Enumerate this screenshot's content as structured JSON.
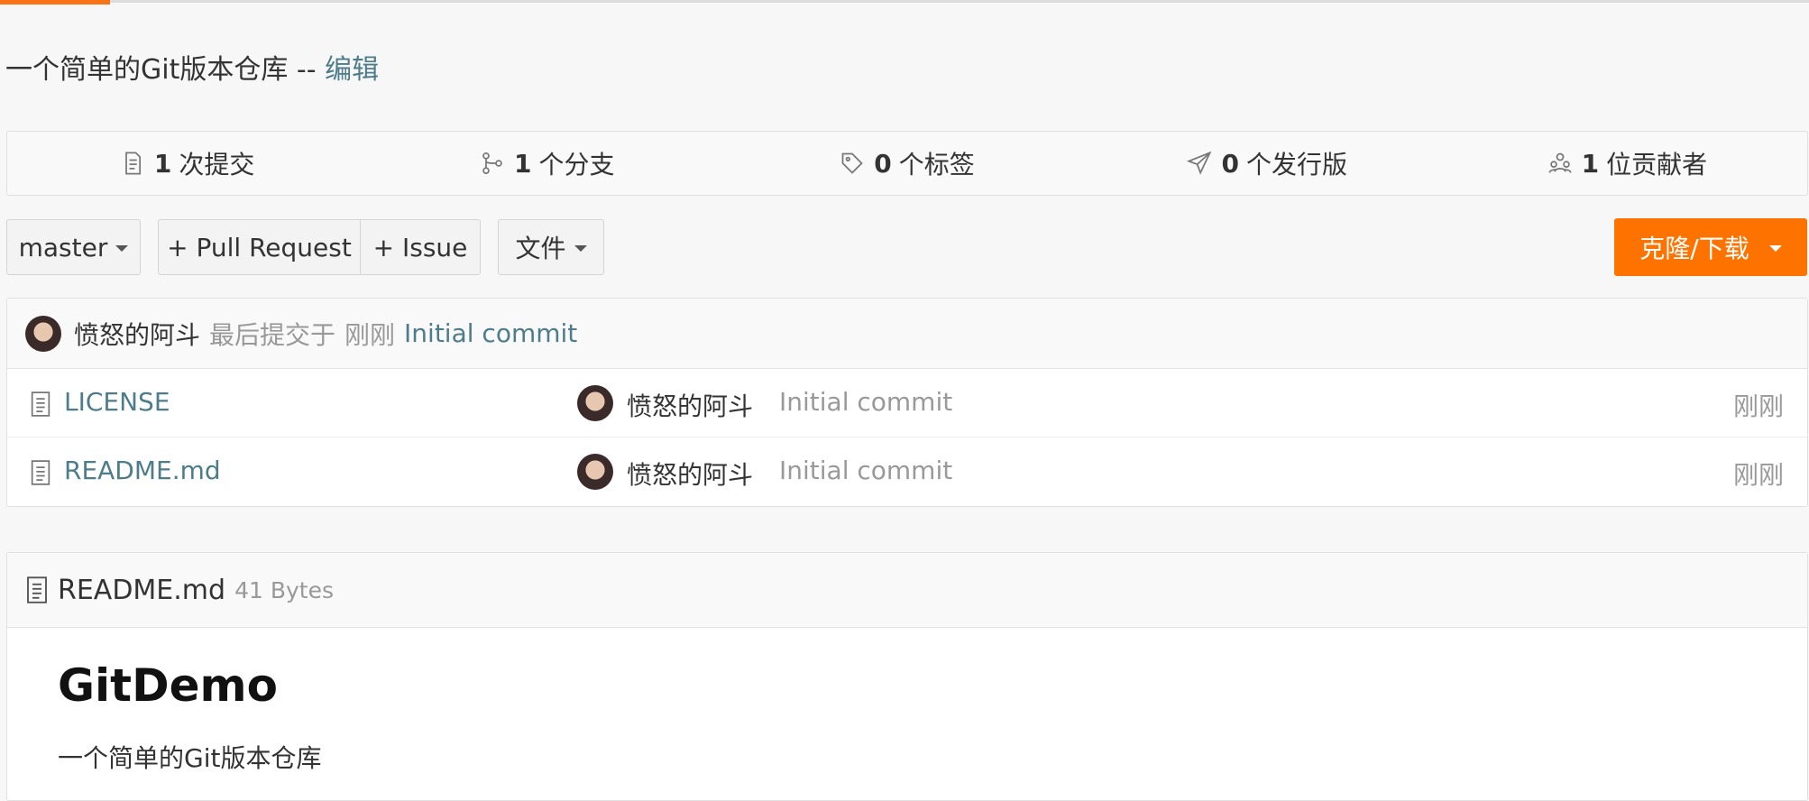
{
  "repo": {
    "description": "一个简单的Git版本仓库 --",
    "edit_label": "编辑"
  },
  "stats": [
    {
      "icon": "commit-icon",
      "count": "1",
      "label": "次提交"
    },
    {
      "icon": "branch-icon",
      "count": "1",
      "label": "个分支"
    },
    {
      "icon": "tag-icon",
      "count": "0",
      "label": "个标签"
    },
    {
      "icon": "release-icon",
      "count": "0",
      "label": "个发行版"
    },
    {
      "icon": "contributors-icon",
      "count": "1",
      "label": "位贡献者"
    }
  ],
  "toolbar": {
    "branch": "master",
    "pull_request": "+ Pull Request",
    "issue": "+ Issue",
    "file_menu": "文件",
    "clone_download": "克隆/下载"
  },
  "latest_commit": {
    "author": "愤怒的阿斗",
    "prefix": "最后提交于",
    "time": "刚刚",
    "message": "Initial commit"
  },
  "files": [
    {
      "name": "LICENSE",
      "author": "愤怒的阿斗",
      "message": "Initial commit",
      "time": "刚刚"
    },
    {
      "name": "README.md",
      "author": "愤怒的阿斗",
      "message": "Initial commit",
      "time": "刚刚"
    }
  ],
  "readme": {
    "filename": "README.md",
    "size": "41 Bytes",
    "heading": "GitDemo",
    "body": "一个简单的Git版本仓库"
  },
  "colors": {
    "accent": "#fe7300",
    "link": "#4d7c8a"
  }
}
